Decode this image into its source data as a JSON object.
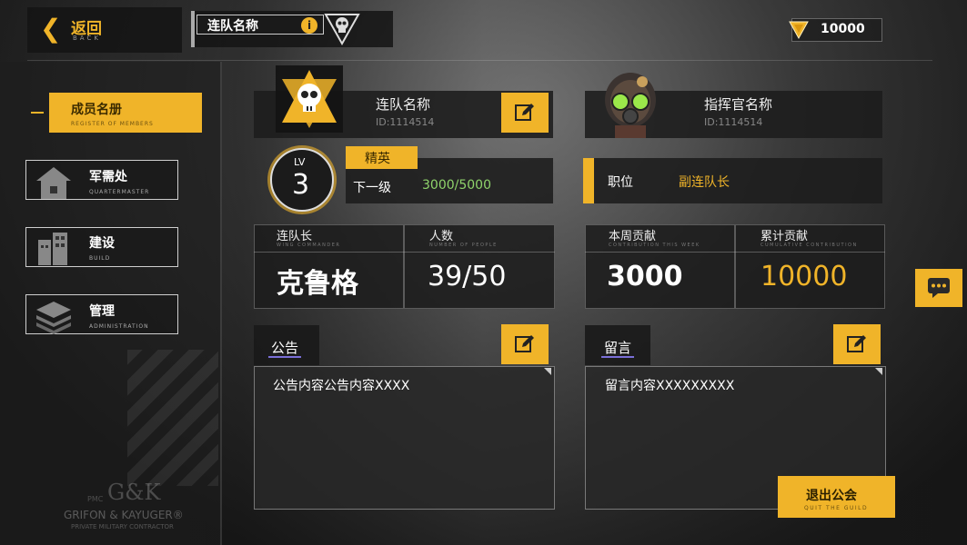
{
  "header": {
    "back_label": "返回",
    "back_sub": "BACK",
    "title": "连队名称",
    "currency_value": "10000"
  },
  "sidebar": {
    "items": [
      {
        "label": "成员名册",
        "sub": "REGISTER OF MEMBERS",
        "active": true
      },
      {
        "label": "军需处",
        "sub": "QUARTERMASTER",
        "active": false
      },
      {
        "label": "建设",
        "sub": "BUILD",
        "active": false
      },
      {
        "label": "管理",
        "sub": "ADMINISTRATION",
        "active": false
      }
    ],
    "watermark_line1": "GRIFON & KAYUGER®",
    "watermark_line2": "PRIVATE MILITARY CONTRACTOR",
    "watermark_logo": "G&K",
    "watermark_prefix": "PMC"
  },
  "team": {
    "name": "连队名称",
    "id": "ID:1114514",
    "level_label": "LV",
    "level": "3",
    "rank": "精英",
    "next_label": "下一级",
    "progress": "3000/5000",
    "leader_label": "连队长",
    "leader_sub": "WING COMMANDER",
    "leader_value": "克鲁格",
    "members_label": "人数",
    "members_sub": "NUMBER OF PEOPLE",
    "members_value": "39/50",
    "announcement_label": "公告",
    "announcement_text": "公告内容公告内容XXXX"
  },
  "commander": {
    "name": "指挥官名称",
    "id": "ID:1114514",
    "position_label": "职位",
    "position_value": "副连队长",
    "weekly_label": "本周贡献",
    "weekly_sub": "CONTRIBUTION THIS WEEK",
    "weekly_value": "3000",
    "total_label": "累计贡献",
    "total_sub": "CUMULATIVE CONTRIBUTION",
    "total_value": "10000",
    "message_label": "留言",
    "message_text": "留言内容XXXXXXXXX"
  },
  "quit": {
    "label": "退出公会",
    "sub": "QUIT THE GUILD"
  },
  "colors": {
    "accent": "#f0b429",
    "panel": "#1c1c1c"
  }
}
